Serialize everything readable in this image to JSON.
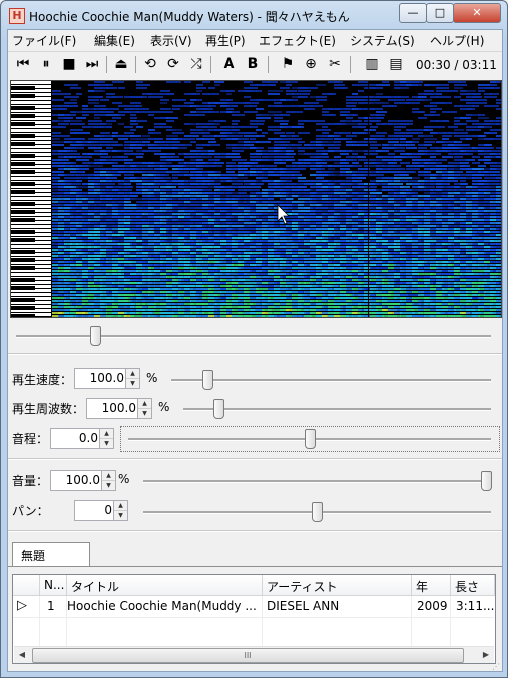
{
  "window": {
    "title": "Hoochie Coochie Man(Muddy Waters) - 聞々ハヤえもん",
    "app_icon_glyph": "H",
    "minimize_glyph": "—",
    "maximize_glyph": "□",
    "close_glyph": "✕"
  },
  "menu": [
    "ファイル(F)",
    "編集(E)",
    "表示(V)",
    "再生(P)",
    "エフェクト(E)",
    "システム(S)",
    "ヘルプ(H)"
  ],
  "toolbar": {
    "buttons": [
      {
        "name": "previous-track",
        "glyph": "⏮"
      },
      {
        "name": "pause",
        "glyph": "⏸"
      },
      {
        "name": "stop",
        "glyph": "■"
      },
      {
        "name": "next-track",
        "glyph": "⏭"
      },
      {
        "name": "eject",
        "glyph": "⏏"
      },
      {
        "name": "loop-all",
        "glyph": "⟲"
      },
      {
        "name": "loop-one",
        "glyph": "⟳"
      },
      {
        "name": "random",
        "glyph": "⤮"
      },
      {
        "name": "ab-point-a",
        "glyph": "A"
      },
      {
        "name": "ab-point-b",
        "glyph": "B"
      },
      {
        "name": "marker-play",
        "glyph": "⚑"
      },
      {
        "name": "add-marker",
        "glyph": "⊕"
      },
      {
        "name": "delete-marker",
        "glyph": "✂"
      },
      {
        "name": "toggle-explorer",
        "glyph": "▥"
      },
      {
        "name": "toggle-playlist",
        "glyph": "▤"
      }
    ],
    "time_readout": "00:30 / 03:11"
  },
  "spectrum": {
    "background": "#000000",
    "seek_position": 0.16
  },
  "controls": {
    "speed": {
      "label": "再生速度：",
      "value": "100.0",
      "unit": "%",
      "slider_position": 0.1
    },
    "frequency": {
      "label": "再生周波数：",
      "value": "100.0",
      "unit": "%",
      "slider_position": 0.1
    },
    "pitch": {
      "label": "音程：",
      "value": "0.0",
      "slider_position": 0.5
    },
    "volume": {
      "label": "音量：",
      "value": "100.0",
      "unit": "%",
      "slider_position": 1.0
    },
    "pan": {
      "label": "パン：",
      "value": "0",
      "slider_position": 0.5
    }
  },
  "playlist": {
    "tab_label": "無題",
    "columns": [
      "N...",
      "タイトル",
      "アーティスト",
      "年",
      "長さ"
    ],
    "rows": [
      {
        "number": "1",
        "title": "Hoochie Coochie Man(Muddy ...",
        "artist": "DIESEL ANN",
        "year": "2009",
        "length": "3:11..."
      }
    ],
    "playing_indicator": "▷",
    "scroll_grip": "III"
  }
}
